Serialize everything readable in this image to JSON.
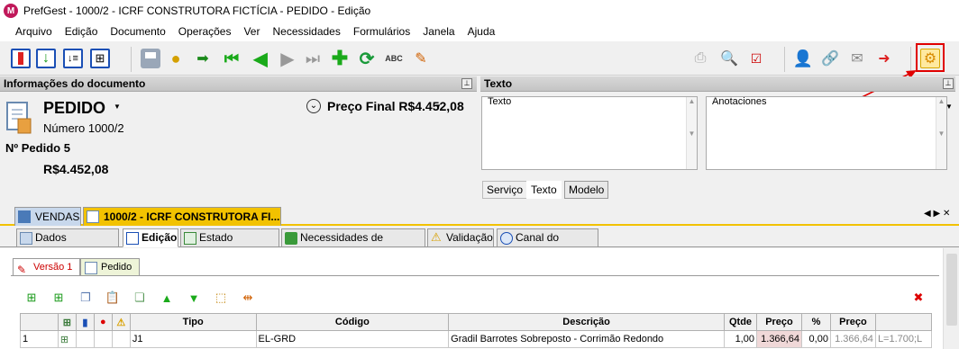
{
  "window": {
    "title": "PrefGest - 1000/2 - ICRF CONSTRUTORA FICTÍCIA - PEDIDO - Edição",
    "app_icon": "prefgest-logo-icon"
  },
  "menu": [
    "Arquivo",
    "Edição",
    "Documento",
    "Operações",
    "Ver",
    "Necessidades",
    "Formulários",
    "Janela",
    "Ajuda"
  ],
  "info_panel": {
    "header": "Informações do documento",
    "doc_type": "PEDIDO",
    "number": "Número 1000/2",
    "order_no": "Nº Pedido 5",
    "amount": "R$4.452,08",
    "final_price": "Preço Final R$4.452,08"
  },
  "texto_panel": {
    "header": "Texto",
    "texto_label": "Texto",
    "anotacoes_label": "Anotaciones",
    "tabs": [
      "Serviço",
      "Texto",
      "Modelo"
    ]
  },
  "doc_tabs": [
    "VENDAS",
    "1000/2 - ICRF CONSTRUTORA FI..."
  ],
  "sub_tabs": [
    "Dados principais",
    "Edição",
    "Estado modelos",
    "Necessidades de material",
    "Validação",
    "Canal do Cliente"
  ],
  "version_tabs": [
    "Versão 1",
    "Pedido"
  ],
  "grid": {
    "headers": [
      "",
      "",
      "",
      "",
      "",
      "Tipo",
      "Código",
      "Descrição",
      "Qtde",
      "Preço",
      "%",
      "Preço",
      ""
    ],
    "rows": [
      {
        "n": "1",
        "tipo": "J1",
        "codigo": "EL-GRD",
        "descricao": "Gradil Barrotes Sobreposto - Corrimão Redondo",
        "qtde": "1,00",
        "preco": "1.366,64",
        "pct": "0,00",
        "preco2": "1.366,64",
        "extra": "L=1.700;L"
      }
    ]
  },
  "colors": {
    "accent_yellow": "#f2c200",
    "highlight_red": "#e00000",
    "price_cell": "#f0d8d8"
  }
}
